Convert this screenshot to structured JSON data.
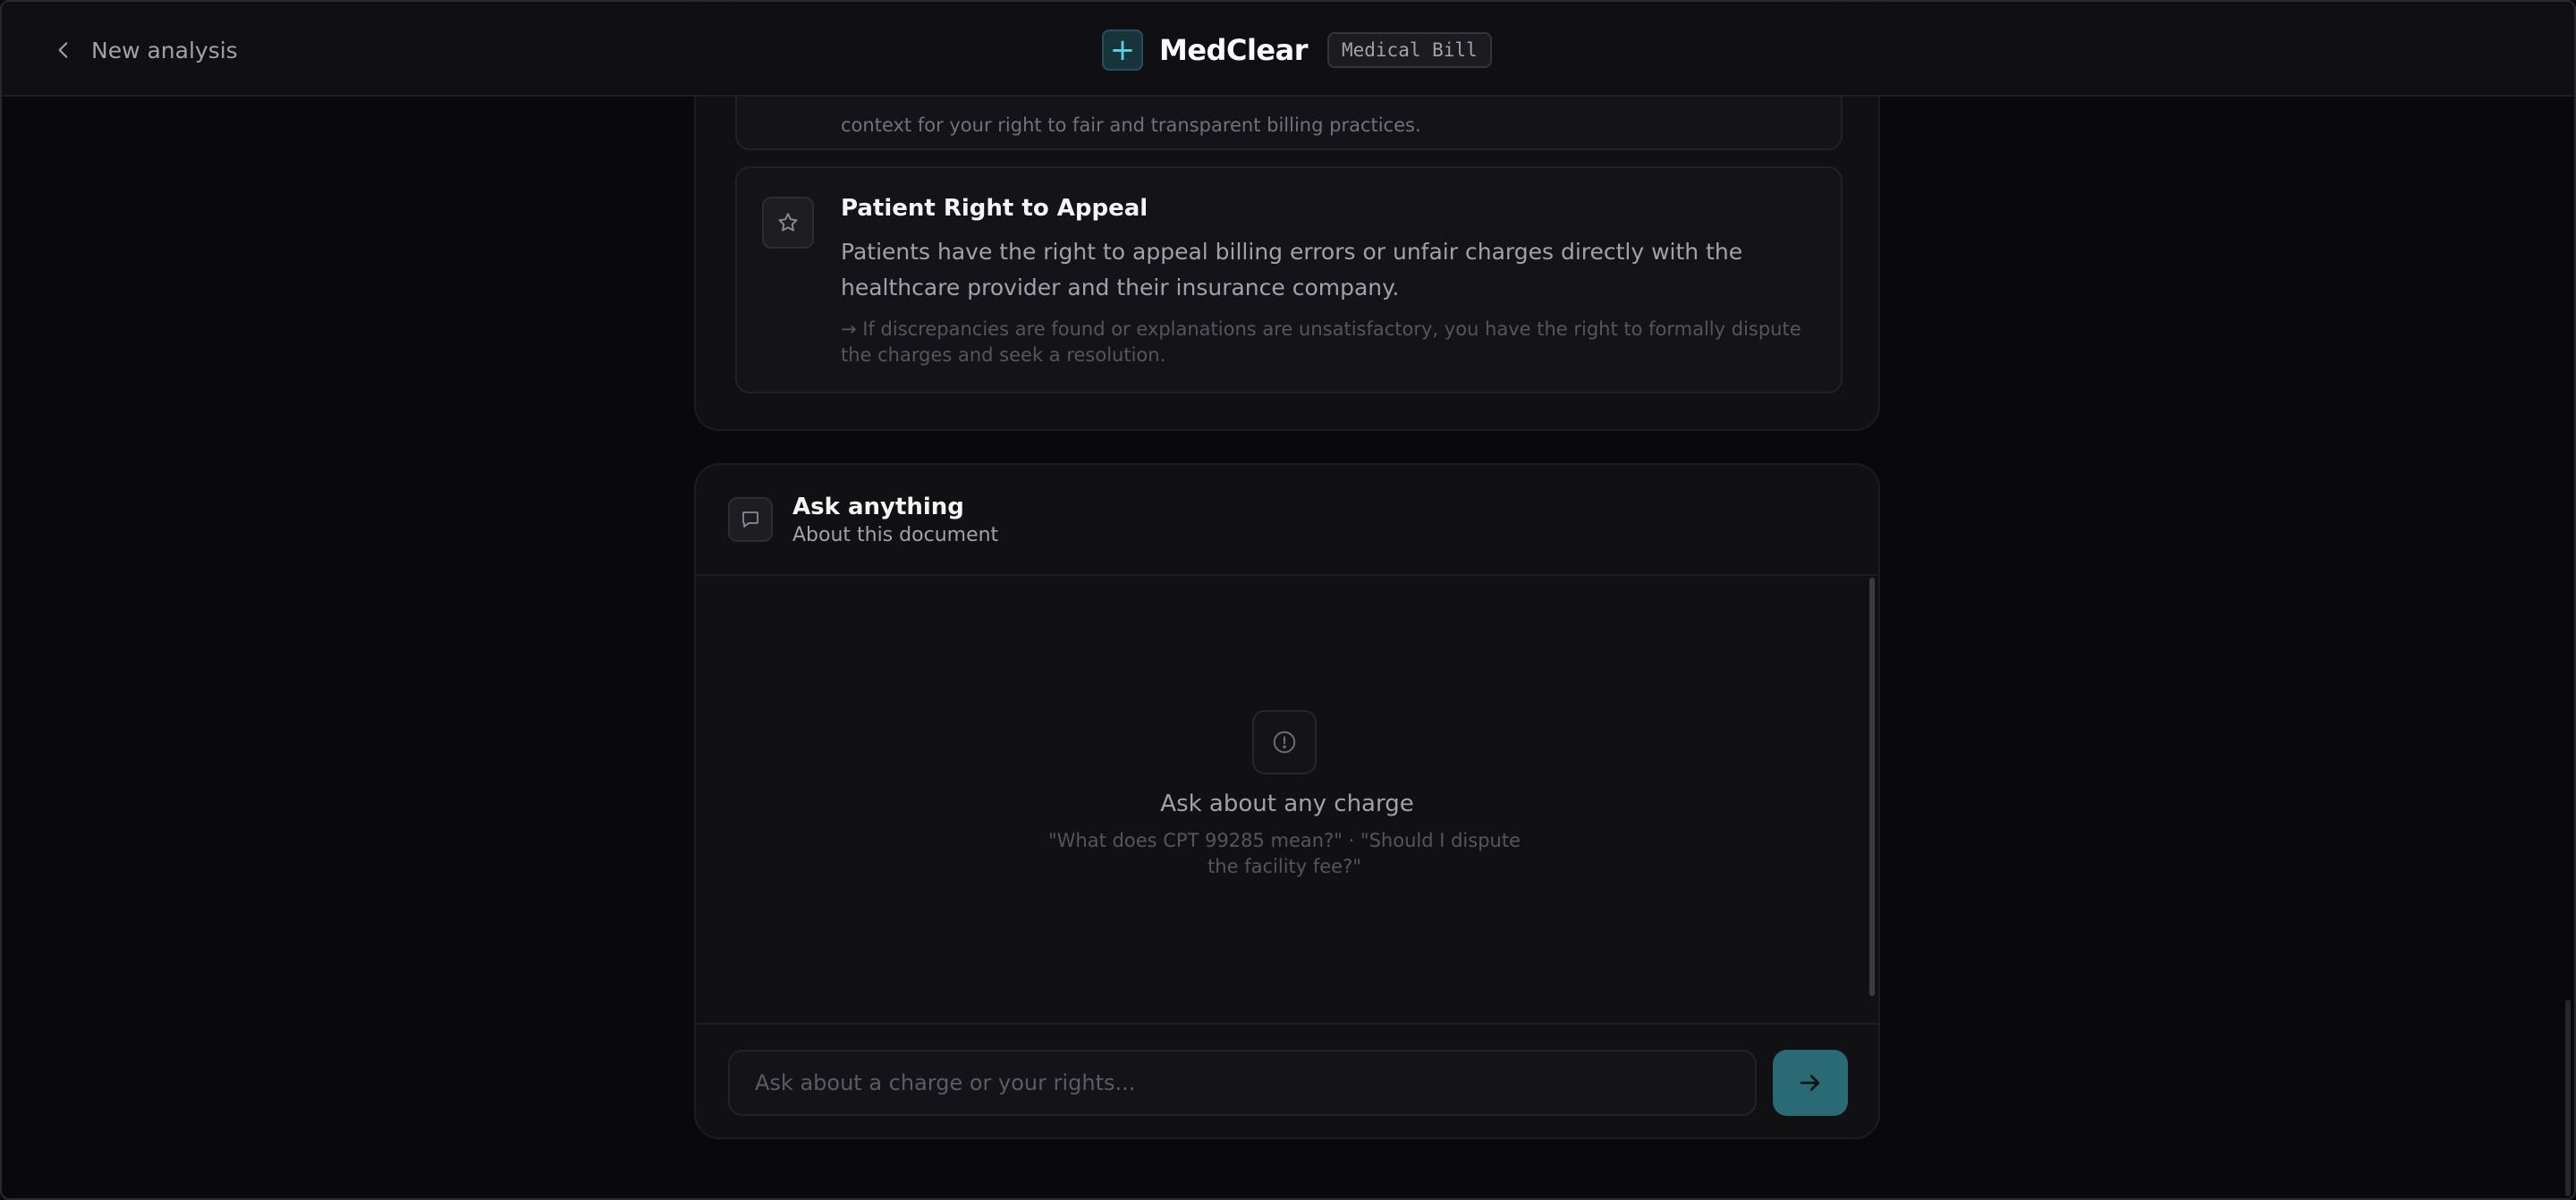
{
  "header": {
    "back_label": "New analysis",
    "brand_icon": "+",
    "app_name": "MedClear",
    "doc_type_badge": "Medical Bill"
  },
  "rights": {
    "previous_item_text": "context for your right to fair and transparent billing practices.",
    "current_item": {
      "title": "Patient Right to Appeal",
      "description": "Patients have the right to appeal billing errors or unfair charges directly with the healthcare provider and their insurance company.",
      "note": "→ If discrepancies are found or explanations are unsatisfactory, you have the right to formally dispute the charges and seek a resolution."
    }
  },
  "ask": {
    "title": "Ask anything",
    "subtitle": "About this document",
    "empty_title": "Ask about any charge",
    "empty_hint": "\"What does CPT 99285 mean?\" · \"Should I dispute the facility fee?\"",
    "input_placeholder": "Ask about a charge or your rights..."
  },
  "icons": {
    "back": "chevron-left-icon",
    "brand": "plus-icon",
    "rights_item": "star-icon",
    "ask": "chat-bubble-icon",
    "empty": "info-circle-icon",
    "send": "arrow-right-icon"
  },
  "colors": {
    "background": "#09090b",
    "card": "#111114",
    "accent": "#2a6a75",
    "accent_text": "#5ad0e0"
  }
}
